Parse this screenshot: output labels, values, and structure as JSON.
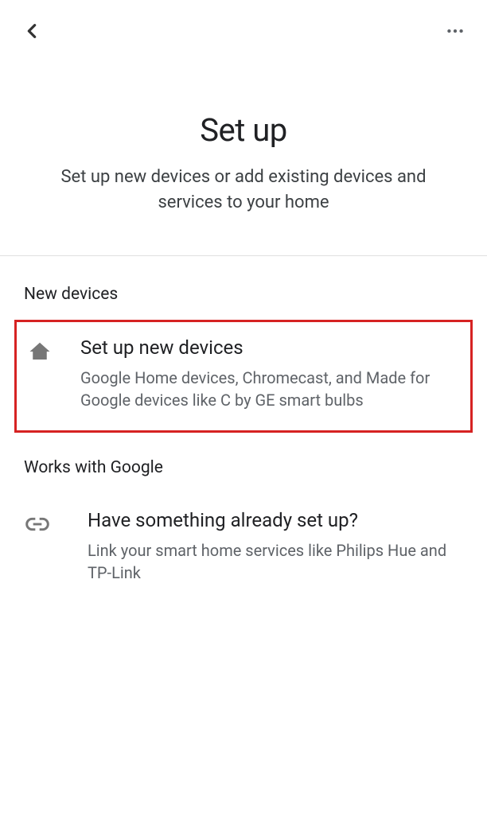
{
  "header": {
    "title": "Set up",
    "subtitle": "Set up new devices or add existing devices and services to your home"
  },
  "sections": {
    "new_devices": {
      "label": "New devices",
      "item": {
        "title": "Set up new devices",
        "description": "Google Home devices, Chromecast, and Made for Google devices like C by GE smart bulbs"
      }
    },
    "works_with_google": {
      "label": "Works with Google",
      "item": {
        "title": "Have something already set up?",
        "description": "Link your smart home services like Philips Hue and TP-Link"
      }
    }
  }
}
